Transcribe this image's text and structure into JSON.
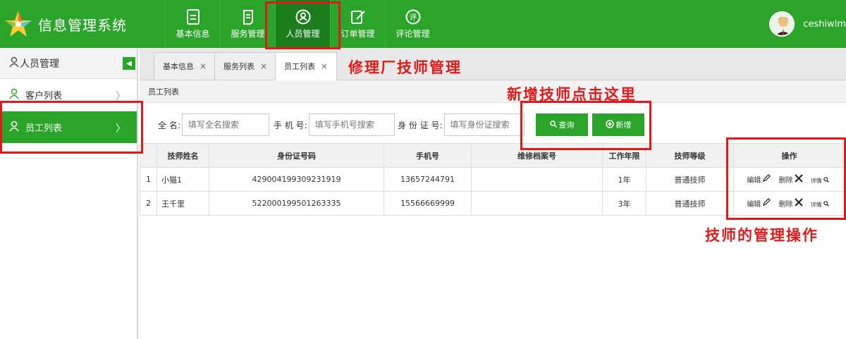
{
  "app": {
    "title": "信息管理系统"
  },
  "nav": [
    {
      "label": "基本信息",
      "icon": "document-icon"
    },
    {
      "label": "服务管理",
      "icon": "list-icon"
    },
    {
      "label": "人员管理",
      "icon": "person-icon",
      "active": true
    },
    {
      "label": "订单管理",
      "icon": "edit-icon"
    },
    {
      "label": "评论管理",
      "icon": "comment-icon",
      "icon_text": "评"
    }
  ],
  "user": {
    "name": "ceshiwlm"
  },
  "sidebar": {
    "header": "人员管理",
    "items": [
      {
        "label": "客户列表"
      },
      {
        "label": "员工列表",
        "active": true
      }
    ]
  },
  "tabs": [
    {
      "label": "基本信息",
      "close": "×"
    },
    {
      "label": "服务列表",
      "close": "×"
    },
    {
      "label": "员工列表",
      "close": "×",
      "active": true
    }
  ],
  "breadcrumb": "员工列表",
  "search": {
    "name_label": "全 名:",
    "name_placeholder": "填写全名搜索",
    "phone_label": "手 机 号:",
    "phone_placeholder": "填写手机号搜索",
    "id_label": "身 份 证 号:",
    "id_placeholder": "填写身份证搜索",
    "query_label": "查询",
    "add_label": "新增"
  },
  "table": {
    "headers": [
      "技师姓名",
      "身份证号码",
      "手机号",
      "维修档案号",
      "工作年限",
      "技师等级",
      "操作"
    ],
    "rows": [
      {
        "index": "1",
        "name": "小猫1",
        "id": "429004199309231919",
        "phone": "13657244791",
        "archive": "",
        "years": "1年",
        "level": "普通技师"
      },
      {
        "index": "2",
        "name": "王千里",
        "id": "522000199501263335",
        "phone": "15566669999",
        "archive": "",
        "years": "3年",
        "level": "普通技师"
      }
    ],
    "actions": {
      "edit": "编辑",
      "delete": "删除",
      "detail": "详情"
    }
  },
  "annotations": {
    "title": "修理厂技师管理",
    "add_hint": "新增技师点击这里",
    "ops_hint": "技师的管理操作"
  },
  "colors": {
    "brand_green": "#2aa52a",
    "active_green": "#1c7d1c",
    "annotation_red": "#e01a1a"
  }
}
